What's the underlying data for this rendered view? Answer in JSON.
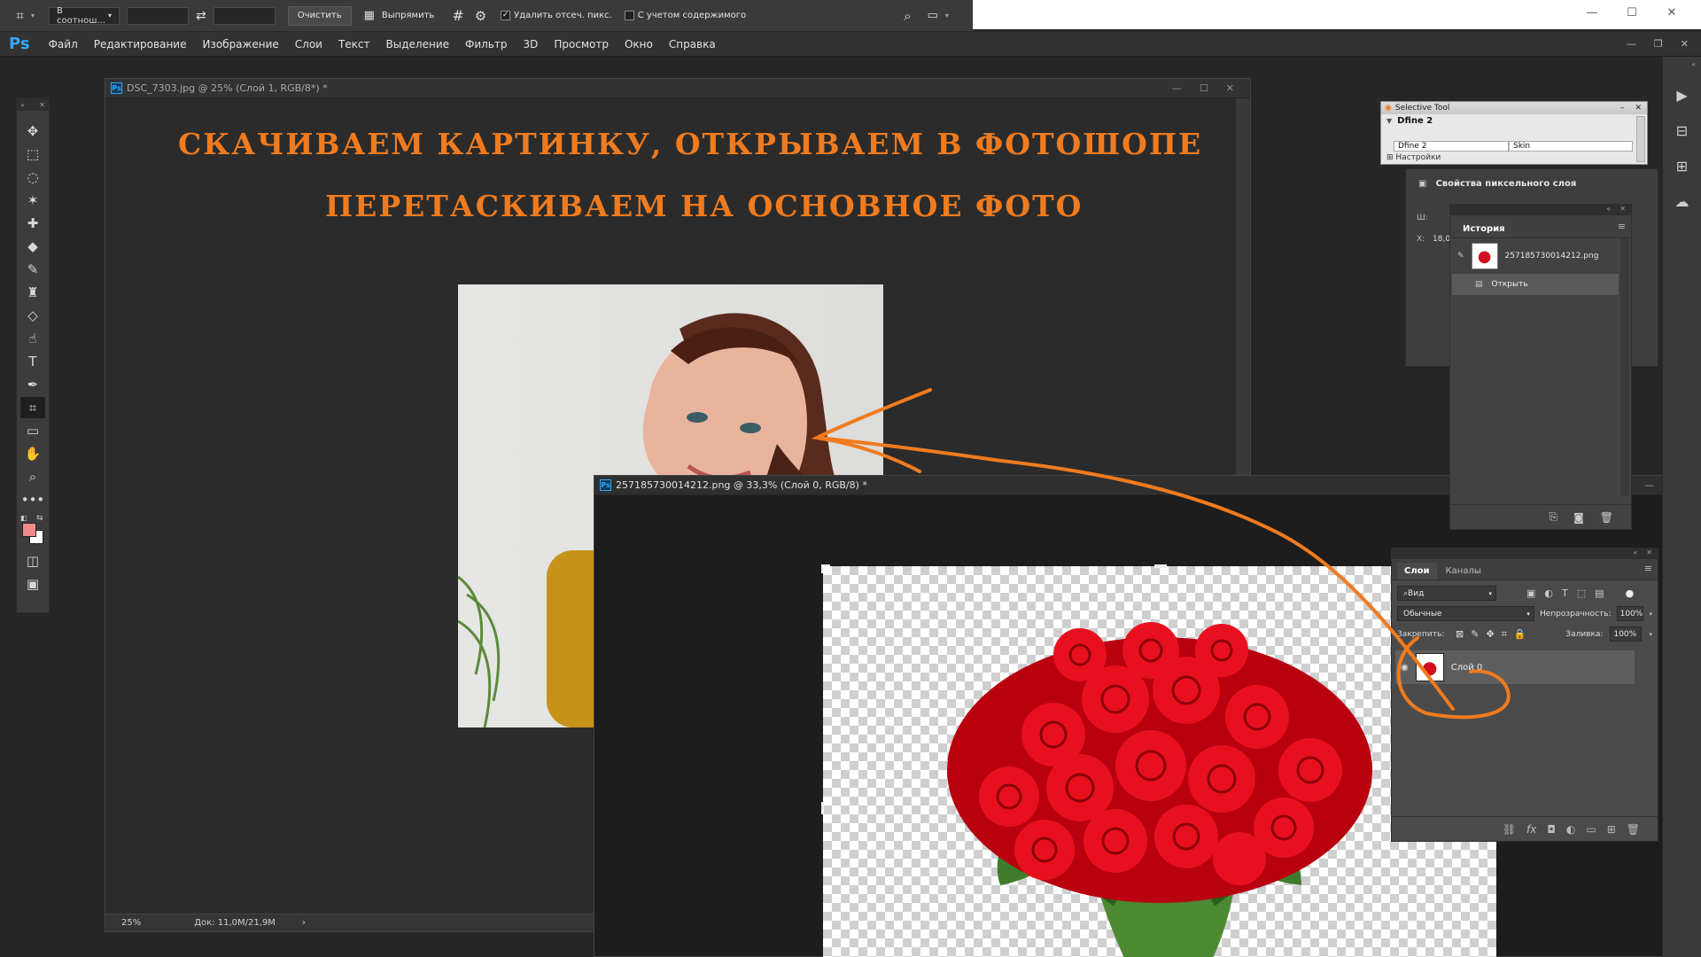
{
  "options_bar": {
    "ratio_label": "В соотнош...",
    "clear_label": "Очистить",
    "straighten_label": "Выпрямить",
    "delete_cropped_label": "Удалить отсеч. пикс.",
    "delete_cropped_checked": true,
    "content_aware_label": "С учетом содержимого",
    "content_aware_checked": false
  },
  "menu": {
    "logo": "Ps",
    "items": [
      "Файл",
      "Редактирование",
      "Изображение",
      "Слои",
      "Текст",
      "Выделение",
      "Фильтр",
      "3D",
      "Просмотр",
      "Окно",
      "Справка"
    ]
  },
  "doc1": {
    "title": "DSC_7303.jpg @ 25% (Слой 1, RGB/8*) *",
    "heading1": "Скачиваем картинку, открываем в фотошопе",
    "heading2": "Перетаскиваем на основное фото",
    "zoom": "25%",
    "doc_size": "Док: 11,0M/21,9M"
  },
  "doc2": {
    "title": "257185730014212.png @ 33,3% (Слой 0, RGB/8) *"
  },
  "selective_tool": {
    "title": "Selective Tool",
    "name": "Dfine 2",
    "row1": "Dfine 2",
    "row2": "Skin",
    "settings": "Настройки"
  },
  "properties": {
    "title": "Свойства пиксельного слоя",
    "w_label": "Ш:",
    "x_label": "X:",
    "x_value": "18,0"
  },
  "history": {
    "title": "История",
    "snapshot": "257185730014212.png",
    "items": [
      "Открыть"
    ]
  },
  "layers": {
    "tabs": [
      "Слои",
      "Каналы"
    ],
    "filter": "Вид",
    "blend_mode": "Обычные",
    "opacity_label": "Непрозрачность:",
    "opacity": "100%",
    "lock_label": "Закрепить:",
    "fill_label": "Заливка:",
    "fill": "100%",
    "layer_name": "Слой 0"
  },
  "colors": {
    "accent_orange": "#f07b1e",
    "foreground": "#f08a8a",
    "background": "#ffffff",
    "ps_blue": "#31a8ff"
  }
}
